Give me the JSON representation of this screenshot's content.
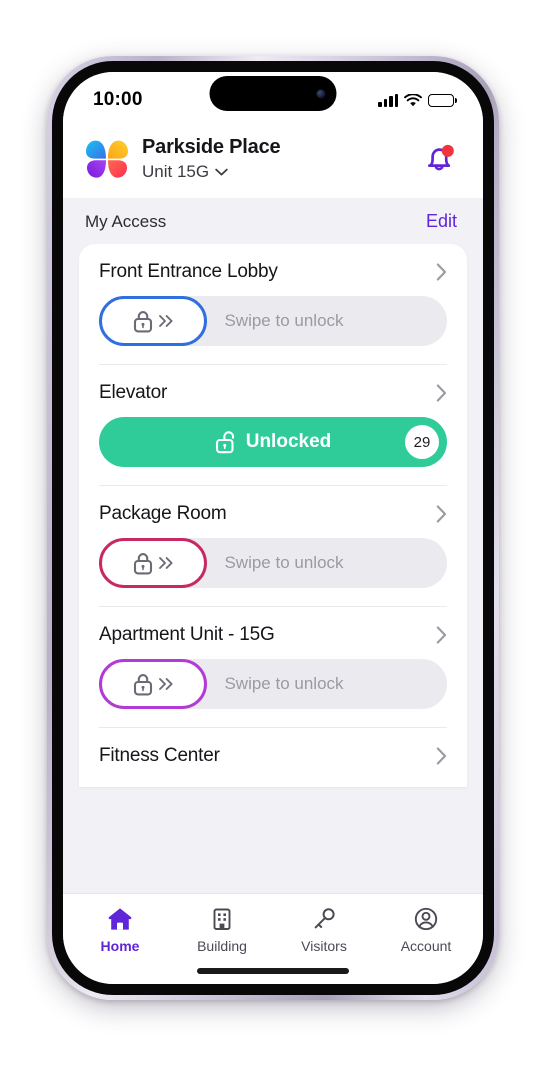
{
  "status_bar": {
    "time": "10:00",
    "signal_icon": "cellular-signal-icon",
    "wifi_icon": "wifi-icon",
    "battery_icon": "battery-full-icon"
  },
  "header": {
    "logo_icon": "butterfly-logo-icon",
    "property_name": "Parkside Place",
    "unit_label": "Unit 15G",
    "unit_chevron_icon": "chevron-down-icon",
    "notification_icon": "bell-icon",
    "notification_has_badge": true
  },
  "section": {
    "title": "My Access",
    "edit_label": "Edit"
  },
  "access_list": [
    {
      "name": "Front Entrance Lobby",
      "state": "locked",
      "swipe_label": "Swipe to unlock",
      "handle_color": "#2f6fe0",
      "lock_icon": "lock-closed-icon",
      "chevron_icon": "double-chevron-right-icon",
      "row_chevron_icon": "chevron-right-icon"
    },
    {
      "name": "Elevator",
      "state": "unlocked",
      "unlocked_label": "Unlocked",
      "countdown": "29",
      "bar_color": "#2fcc9a",
      "lock_icon": "lock-open-icon",
      "row_chevron_icon": "chevron-right-icon"
    },
    {
      "name": "Package Room",
      "state": "locked",
      "swipe_label": "Swipe to unlock",
      "handle_color": "#c72a63",
      "lock_icon": "lock-closed-icon",
      "chevron_icon": "double-chevron-right-icon",
      "row_chevron_icon": "chevron-right-icon"
    },
    {
      "name": "Apartment Unit - 15G",
      "state": "locked",
      "swipe_label": "Swipe to unlock",
      "handle_color": "#b23ad6",
      "lock_icon": "lock-closed-icon",
      "chevron_icon": "double-chevron-right-icon",
      "row_chevron_icon": "chevron-right-icon"
    },
    {
      "name": "Fitness Center",
      "state": "title-only",
      "row_chevron_icon": "chevron-right-icon"
    }
  ],
  "tabs": [
    {
      "label": "Home",
      "icon": "home-icon",
      "active": true
    },
    {
      "label": "Building",
      "icon": "building-icon",
      "active": false
    },
    {
      "label": "Visitors",
      "icon": "key-icon",
      "active": false
    },
    {
      "label": "Account",
      "icon": "account-icon",
      "active": false
    }
  ],
  "colors": {
    "accent_purple": "#6025d9",
    "unlocked_green": "#2fcc9a",
    "page_background": "#f2f2f6",
    "card_background": "#ffffff",
    "track_background": "#ebebef",
    "hint_text": "#9a9aa3",
    "notification_red": "#f0333f"
  }
}
